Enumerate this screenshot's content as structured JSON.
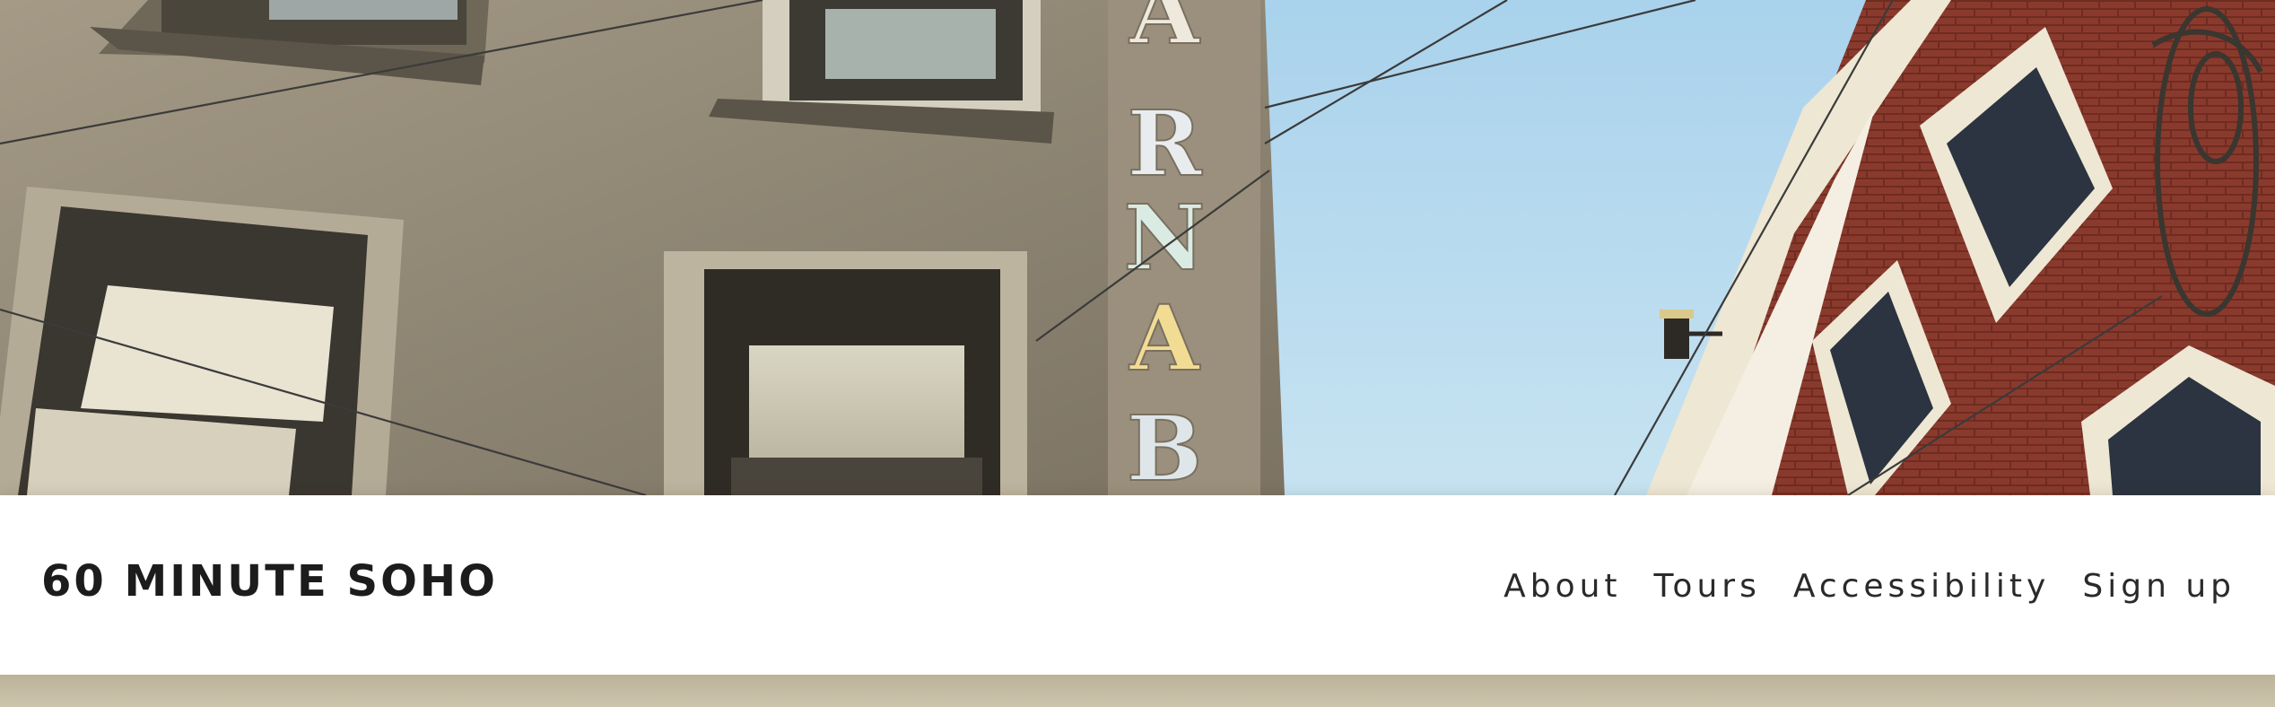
{
  "hero": {
    "image": "photo-looking-up-soho-street",
    "sign_letters": [
      "A",
      "R",
      "N",
      "A",
      "B"
    ],
    "colors": {
      "sky": "#b9dcef",
      "facade": "#8e8574",
      "brick": "#8a3a2c",
      "trim": "#efe9d9"
    }
  },
  "nav": {
    "brand": "60 MINUTE SOHO",
    "links": [
      "About",
      "Tours",
      "Accessibility",
      "Sign up"
    ]
  }
}
